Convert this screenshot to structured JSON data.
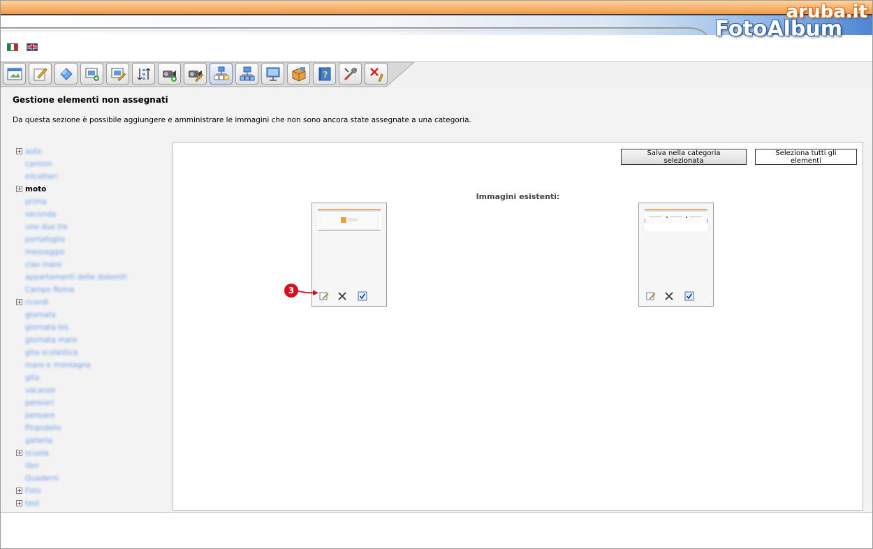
{
  "header": {
    "brand_aruba": "aruba.it",
    "brand_product": "FotoAlbum"
  },
  "languages": [
    {
      "code": "it",
      "icon": "italian-flag-icon"
    },
    {
      "code": "en",
      "icon": "uk-flag-icon"
    }
  ],
  "toolbar": {
    "buttons": [
      {
        "icon": "album-icon"
      },
      {
        "icon": "edit-note-icon"
      },
      {
        "icon": "gem-icon"
      },
      {
        "icon": "image-add-icon"
      },
      {
        "icon": "image-edit-icon"
      },
      {
        "icon": "sort-order-icon"
      },
      {
        "icon": "video-add-icon"
      },
      {
        "icon": "video-edit-icon"
      },
      {
        "icon": "unassigned-items-icon",
        "active": true
      },
      {
        "icon": "category-tree-icon"
      },
      {
        "icon": "monitor-icon"
      },
      {
        "icon": "package-icon"
      },
      {
        "icon": "help-book-icon"
      },
      {
        "icon": "settings-tools-icon"
      },
      {
        "icon": "logout-icon"
      }
    ]
  },
  "page": {
    "title": "Gestione elementi non assegnati",
    "description": "Da questa sezione è possibile aggiungere e amministrare le immagini che non sono ancora state assegnate a una categoria."
  },
  "tree": {
    "items": [
      {
        "label": "auto",
        "expandable": true,
        "level": 0
      },
      {
        "label": "camion",
        "expandable": false,
        "level": 1
      },
      {
        "label": "elicotteri",
        "expandable": false,
        "level": 1
      },
      {
        "label": "moto",
        "expandable": true,
        "level": 0,
        "selected": true
      },
      {
        "label": "prima",
        "expandable": false,
        "level": 1
      },
      {
        "label": "seconda",
        "expandable": false,
        "level": 1
      },
      {
        "label": "uno due tre",
        "expandable": false,
        "level": 1
      },
      {
        "label": "portafoglio",
        "expandable": false,
        "level": 1
      },
      {
        "label": "messaggio",
        "expandable": false,
        "level": 1
      },
      {
        "label": "ciao mare",
        "expandable": false,
        "level": 1
      },
      {
        "label": "appartamenti delle dolomiti",
        "expandable": false,
        "level": 1
      },
      {
        "label": "Campo Roma",
        "expandable": false,
        "level": 1
      },
      {
        "label": "ricordi",
        "expandable": true,
        "level": 0
      },
      {
        "label": "giornata",
        "expandable": false,
        "level": 1
      },
      {
        "label": "giornata bis",
        "expandable": false,
        "level": 1
      },
      {
        "label": "giornata mare",
        "expandable": false,
        "level": 1
      },
      {
        "label": "gita scolastica",
        "expandable": false,
        "level": 1
      },
      {
        "label": "mare e montagna",
        "expandable": false,
        "level": 1
      },
      {
        "label": "gita",
        "expandable": false,
        "level": 1
      },
      {
        "label": "vacanze",
        "expandable": false,
        "level": 1
      },
      {
        "label": "pensieri",
        "expandable": false,
        "level": 1
      },
      {
        "label": "pensare",
        "expandable": false,
        "level": 1
      },
      {
        "label": "Pirandello",
        "expandable": false,
        "level": 1
      },
      {
        "label": "galleria",
        "expandable": false,
        "level": 1
      },
      {
        "label": "scuola",
        "expandable": true,
        "level": 0
      },
      {
        "label": "libri",
        "expandable": false,
        "level": 1
      },
      {
        "label": "Quaderni",
        "expandable": false,
        "level": 1
      },
      {
        "label": "Foto",
        "expandable": true,
        "level": 0
      },
      {
        "label": "test",
        "expandable": true,
        "level": 0
      }
    ]
  },
  "panel": {
    "save_button": "Salva nella categoria selezionata",
    "select_all_button": "Seleziona tutti gli elementi",
    "existing_images_label": "Immagini esistenti:",
    "thumbnails": [
      {
        "actions": [
          "edit-icon",
          "delete-icon",
          "checkbox-checked-icon"
        ]
      },
      {
        "actions": [
          "edit-icon",
          "delete-icon",
          "checkbox-checked-icon"
        ]
      }
    ],
    "callout": "3"
  }
}
